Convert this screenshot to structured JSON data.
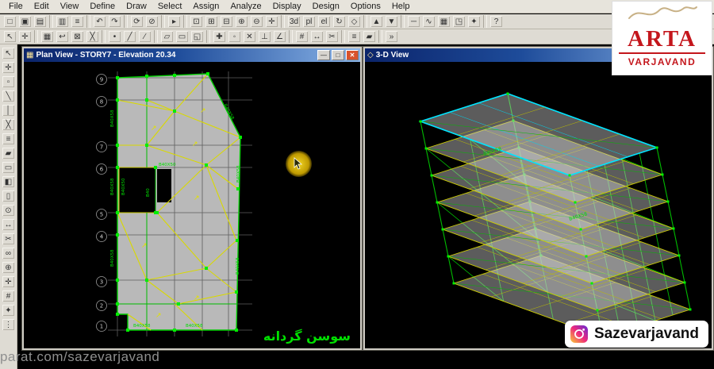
{
  "app": {
    "menus": [
      "File",
      "Edit",
      "View",
      "Define",
      "Draw",
      "Select",
      "Assign",
      "Analyze",
      "Display",
      "Design",
      "Options",
      "Help"
    ]
  },
  "toolbar_row1": [
    {
      "name": "new-model",
      "glyph": "□"
    },
    {
      "name": "open-model",
      "glyph": "▣"
    },
    {
      "name": "save-model",
      "glyph": "▤"
    },
    {
      "name": "separator",
      "glyph": ""
    },
    {
      "name": "print-graphics",
      "glyph": "▥"
    },
    {
      "name": "print-tables",
      "glyph": "≡"
    },
    {
      "name": "separator",
      "glyph": ""
    },
    {
      "name": "undo",
      "glyph": "↶"
    },
    {
      "name": "redo",
      "glyph": "↷"
    },
    {
      "name": "separator",
      "glyph": ""
    },
    {
      "name": "refresh-window",
      "glyph": "⟳"
    },
    {
      "name": "lock-model",
      "glyph": "⊘"
    },
    {
      "name": "separator",
      "glyph": ""
    },
    {
      "name": "run-analysis",
      "glyph": "▸"
    },
    {
      "name": "separator",
      "glyph": ""
    },
    {
      "name": "rubber-band-zoom",
      "glyph": "⊡"
    },
    {
      "name": "restore-full-view",
      "glyph": "⊞"
    },
    {
      "name": "previous-zoom",
      "glyph": "⊟"
    },
    {
      "name": "zoom-in",
      "glyph": "⊕"
    },
    {
      "name": "zoom-out",
      "glyph": "⊖"
    },
    {
      "name": "pan",
      "glyph": "✛"
    },
    {
      "name": "separator",
      "glyph": ""
    },
    {
      "name": "view-3d",
      "glyph": "3d"
    },
    {
      "name": "plan-view",
      "glyph": "pl"
    },
    {
      "name": "elevation-view",
      "glyph": "el"
    },
    {
      "name": "rotate-3d-view",
      "glyph": "↻"
    },
    {
      "name": "perspective-toggle",
      "glyph": "◇"
    },
    {
      "name": "separator",
      "glyph": ""
    },
    {
      "name": "move-up-list",
      "glyph": "▲"
    },
    {
      "name": "move-down-list",
      "glyph": "▼"
    },
    {
      "name": "separator",
      "glyph": ""
    },
    {
      "name": "show-undeformed",
      "glyph": "─"
    },
    {
      "name": "show-deformed",
      "glyph": "∿"
    },
    {
      "name": "show-output-tables",
      "glyph": "▦"
    },
    {
      "name": "object-shrink",
      "glyph": "◳"
    },
    {
      "name": "view-options",
      "glyph": "✦"
    },
    {
      "name": "separator",
      "glyph": ""
    },
    {
      "name": "help-pointer",
      "glyph": "?"
    }
  ],
  "toolbar_row2": [
    {
      "name": "pointer-select",
      "glyph": "↖"
    },
    {
      "name": "reshape-object",
      "glyph": "✛"
    },
    {
      "name": "separator",
      "glyph": ""
    },
    {
      "name": "select-all",
      "glyph": "▦"
    },
    {
      "name": "restore-previous-selection",
      "glyph": "↩"
    },
    {
      "name": "clear-selection",
      "glyph": "⊠"
    },
    {
      "name": "intersecting-line-select",
      "glyph": "╳"
    },
    {
      "name": "separator",
      "glyph": ""
    },
    {
      "name": "draw-special-joint",
      "glyph": "•"
    },
    {
      "name": "draw-frame",
      "glyph": "╱"
    },
    {
      "name": "draw-quick-frame",
      "glyph": "∕"
    },
    {
      "name": "separator",
      "glyph": ""
    },
    {
      "name": "draw-area",
      "glyph": "▱"
    },
    {
      "name": "draw-rect-area",
      "glyph": "▭"
    },
    {
      "name": "draw-quick-area",
      "glyph": "◱"
    },
    {
      "name": "separator",
      "glyph": ""
    },
    {
      "name": "snap-joints",
      "glyph": "✚"
    },
    {
      "name": "snap-midpoints",
      "glyph": "◦"
    },
    {
      "name": "snap-intersections",
      "glyph": "✕"
    },
    {
      "name": "snap-perpendicular",
      "glyph": "⊥"
    },
    {
      "name": "snap-lines",
      "glyph": "∠"
    },
    {
      "name": "separator",
      "glyph": ""
    },
    {
      "name": "grid-lines",
      "glyph": "#"
    },
    {
      "name": "measure",
      "glyph": "↔"
    },
    {
      "name": "section-cut",
      "glyph": "✂"
    },
    {
      "name": "separator",
      "glyph": ""
    },
    {
      "name": "assign-frame",
      "glyph": "≡"
    },
    {
      "name": "assign-area",
      "glyph": "▰"
    },
    {
      "name": "separator",
      "glyph": ""
    },
    {
      "name": "named-display",
      "glyph": "»"
    }
  ],
  "toolbar_side": [
    {
      "name": "pointer",
      "glyph": "↖"
    },
    {
      "name": "reshape",
      "glyph": "✛"
    },
    {
      "name": "draw-joint",
      "glyph": "▫"
    },
    {
      "name": "draw-frame-side",
      "glyph": "╲"
    },
    {
      "name": "draw-quick-frame-side",
      "glyph": "│"
    },
    {
      "name": "draw-braces",
      "glyph": "╳"
    },
    {
      "name": "draw-secondary-beams",
      "glyph": "≡"
    },
    {
      "name": "draw-floor-area",
      "glyph": "▰"
    },
    {
      "name": "draw-rect-area-side",
      "glyph": "▭"
    },
    {
      "name": "draw-quick-area-side",
      "glyph": "◧"
    },
    {
      "name": "draw-wall",
      "glyph": "▯"
    },
    {
      "name": "draw-ref-point",
      "glyph": "⊙"
    },
    {
      "name": "draw-dimension",
      "glyph": "↔"
    },
    {
      "name": "section-cut-side",
      "glyph": "✂"
    },
    {
      "name": "draw-link",
      "glyph": "∞"
    },
    {
      "name": "zoom-tool",
      "glyph": "⊕"
    },
    {
      "name": "pan-tool",
      "glyph": "✛"
    },
    {
      "name": "grid-tool",
      "glyph": "#"
    },
    {
      "name": "options-tool",
      "glyph": "✦"
    },
    {
      "name": "more-tools",
      "glyph": "⋮"
    }
  ],
  "windows": {
    "plan": {
      "title": "Plan View - STORY7 - Elevation 20.34",
      "minimize": "—",
      "restore": "□",
      "close": "✕"
    },
    "view3d": {
      "title": "3-D View",
      "minimize": "—",
      "restore": "□",
      "close": "✕"
    }
  },
  "plan": {
    "grid_bubbles": [
      "9",
      "8",
      "7",
      "6",
      "5",
      "4",
      "3",
      "2",
      "1"
    ],
    "labels": [
      "B40X58",
      "B40X50",
      "B40"
    ],
    "caption": "سوسن گردانه"
  },
  "view3d": {
    "labels": [
      "B40X58",
      "B40X58"
    ]
  },
  "branding": {
    "logo_top": "ARTA",
    "logo_bottom": "VARJAVAND",
    "instagram": "Sazevarjavand",
    "watermark": "aparat.com/sazevarjavand"
  }
}
